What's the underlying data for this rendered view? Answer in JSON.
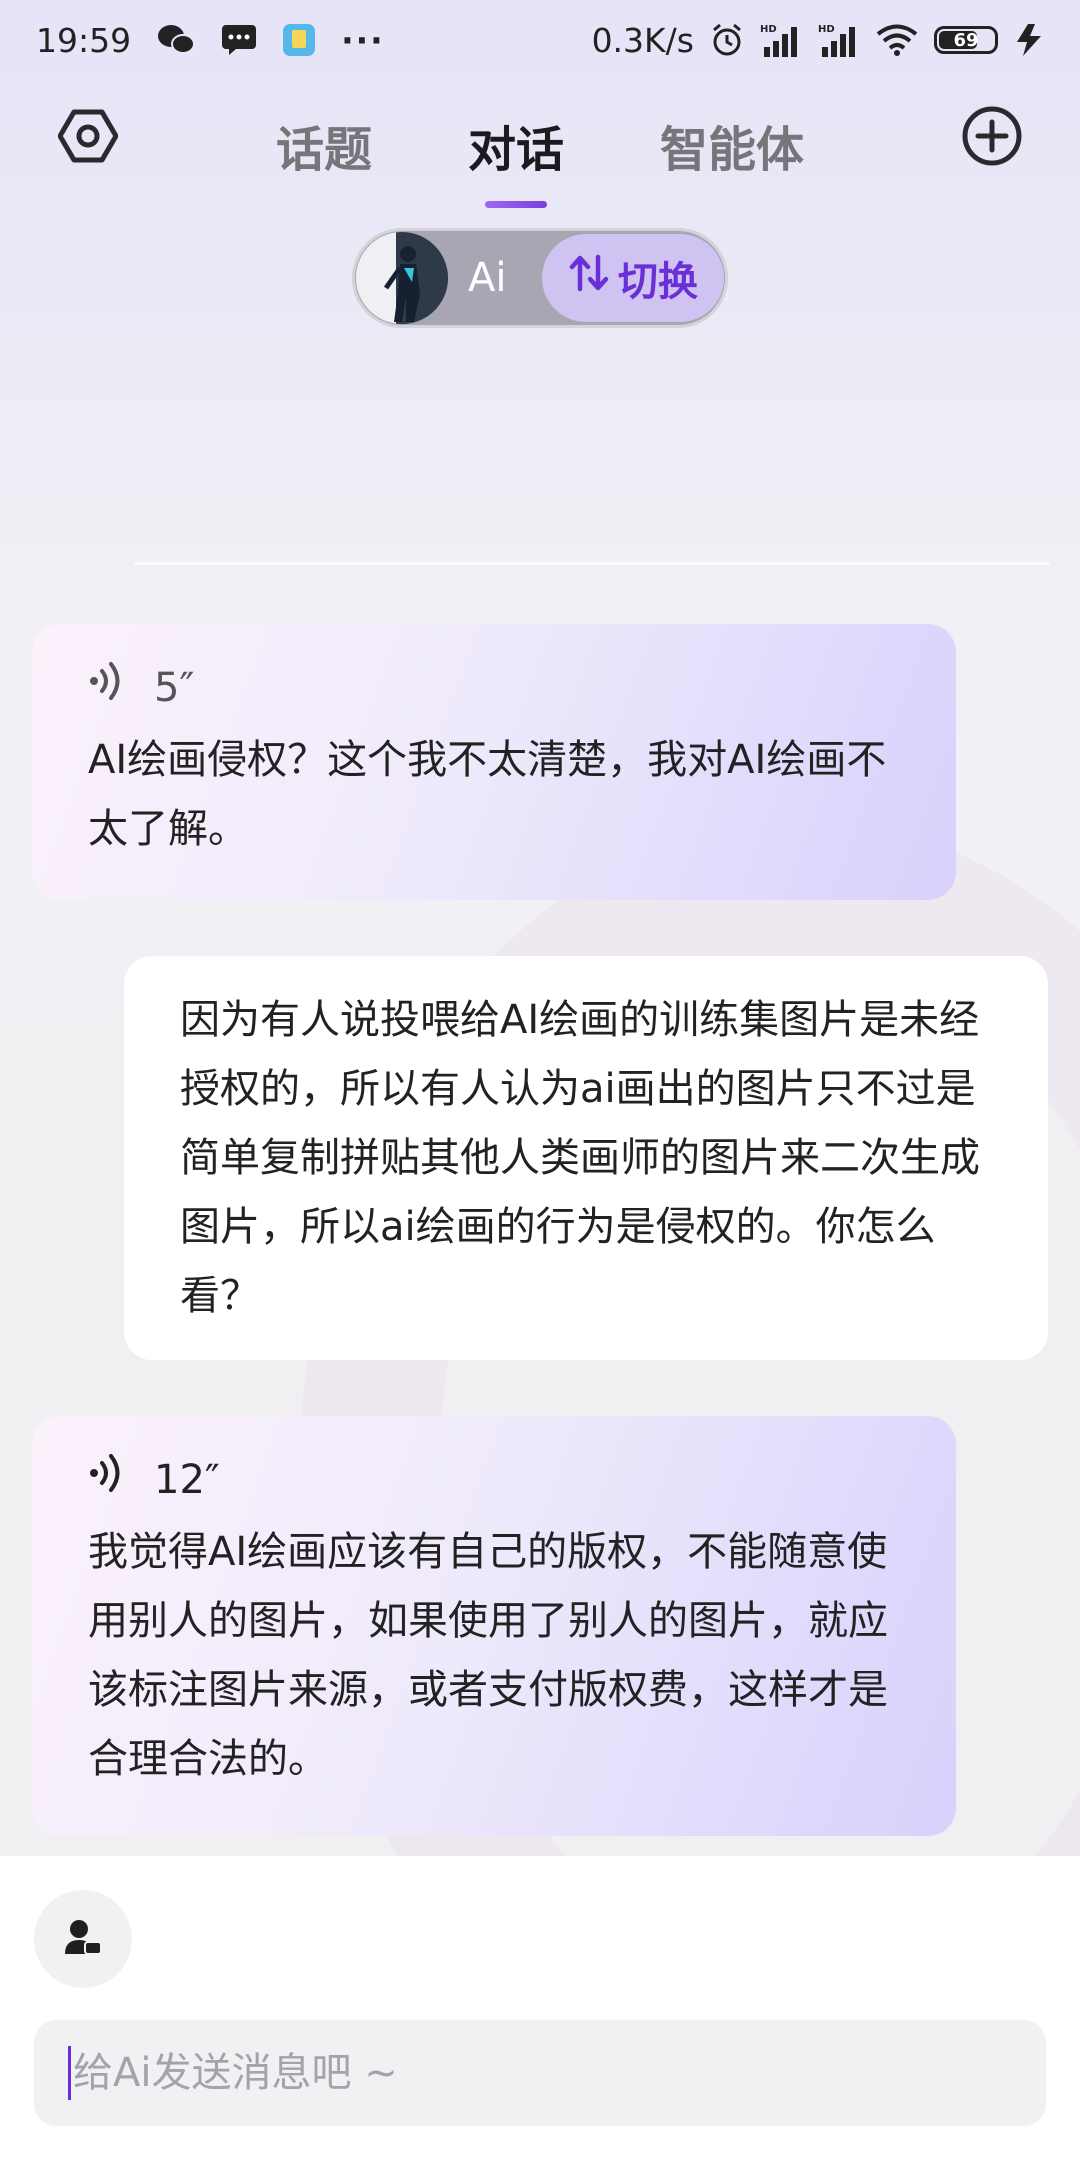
{
  "status_bar": {
    "time": "19:59",
    "net_speed": "0.3K/s",
    "signal_tag": "HD",
    "battery": "69",
    "more": "···"
  },
  "header": {
    "tabs": [
      {
        "label": "话题"
      },
      {
        "label": "对话"
      },
      {
        "label": "智能体"
      }
    ],
    "active_tab": 1
  },
  "agent": {
    "name": "Ai",
    "switch_label": "切换"
  },
  "messages": [
    {
      "role": "ai",
      "duration": "5″",
      "text": "AI绘画侵权？这个我不太清楚，我对AI绘画不太了解。"
    },
    {
      "role": "user",
      "text": "因为有人说投喂给AI绘画的训练集图片是未经授权的，所以有人认为ai画出的图片只不过是简单复制拼贴其他人类画师的图片来二次生成图片，所以ai绘画的行为是侵权的。你怎么看？"
    },
    {
      "role": "ai",
      "duration": "12″",
      "text": "我觉得AI绘画应该有自己的版权，不能随意使用别人的图片，如果使用了别人的图片，就应该标注图片来源，或者支付版权费，这样才是合理合法的。"
    }
  ],
  "input": {
    "placeholder": "给Ai发送消息吧 ~"
  },
  "colors": {
    "accent": "#7c3ee0",
    "switch_bg": "#cfc3f1",
    "ai_bubble_end": "#d8d1fc",
    "ai_bubble_start": "#fbf1fb"
  },
  "icons": [
    "settings-icon",
    "add-circle-icon",
    "switch-arrows-icon",
    "voice-wave-icon",
    "user-role-icon",
    "wechat-icon",
    "message-icon",
    "app-icon",
    "alarm-icon",
    "signal-icon",
    "wifi-icon",
    "battery-icon",
    "charging-icon"
  ]
}
